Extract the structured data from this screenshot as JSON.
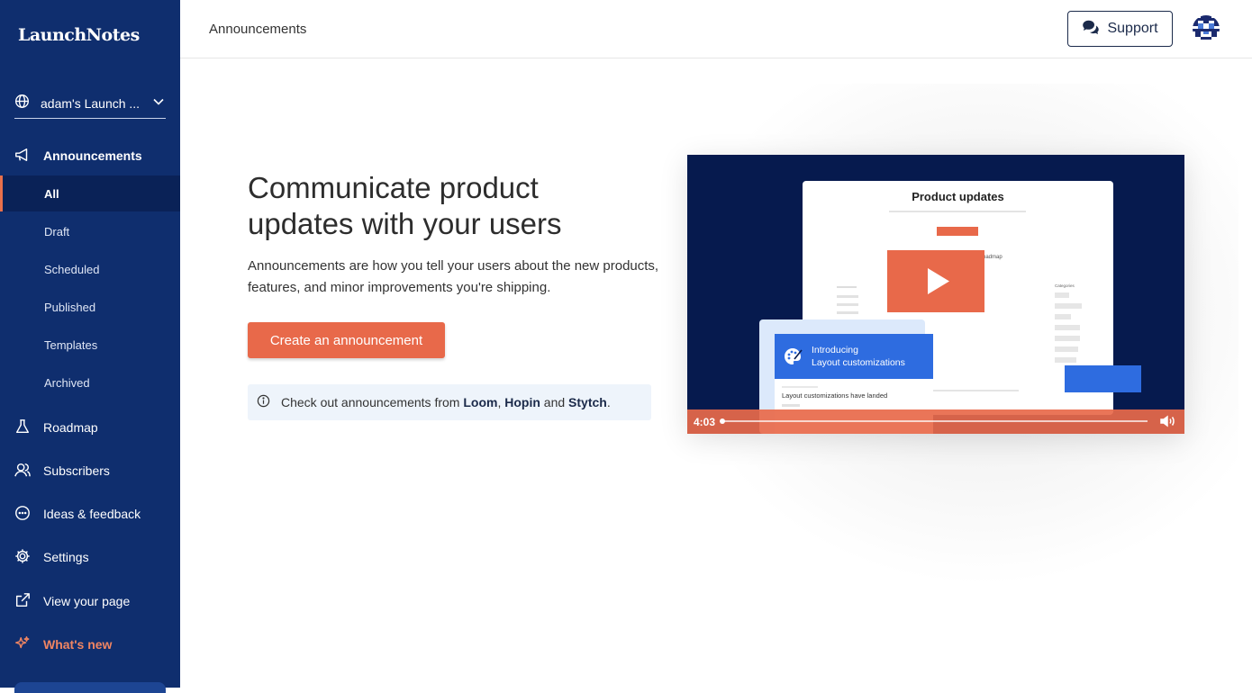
{
  "sidebar": {
    "logo": "LaunchNotes",
    "workspace": "adam's Launch ...",
    "announcements": {
      "label": "Announcements",
      "sub_items": [
        "All",
        "Draft",
        "Scheduled",
        "Published",
        "Templates",
        "Archived"
      ],
      "active": "All"
    },
    "items": [
      "Roadmap",
      "Subscribers",
      "Ideas & feedback",
      "Settings",
      "View your page"
    ],
    "whats_new": "What's new"
  },
  "header": {
    "title": "Announcements",
    "support_label": "Support"
  },
  "main": {
    "heading": "Communicate product updates with your users",
    "description": "Announcements are how you tell your users about the new products, features, and minor improvements you're shipping.",
    "cta_label": "Create an announcement",
    "info": {
      "prefix": "Check out announcements from ",
      "links": [
        "Loom",
        "Hopin",
        "Stytch"
      ],
      "sep1": ", ",
      "sep2": " and ",
      "suffix": "."
    }
  },
  "video": {
    "mock_title": "Product updates",
    "card_title_1": "Introducing",
    "card_title_2": "Layout customizations",
    "card_subtitle": "Layout customizations have landed",
    "mock_side_label": "Categories",
    "mock_roadmap_label": "oadmap",
    "time": "4:03"
  },
  "colors": {
    "sidebar": "#0f2e6e",
    "accent": "#e8694a",
    "whats_new": "#f08562",
    "video_bg": "#061a4e",
    "card_blue": "#2e6ce0"
  }
}
